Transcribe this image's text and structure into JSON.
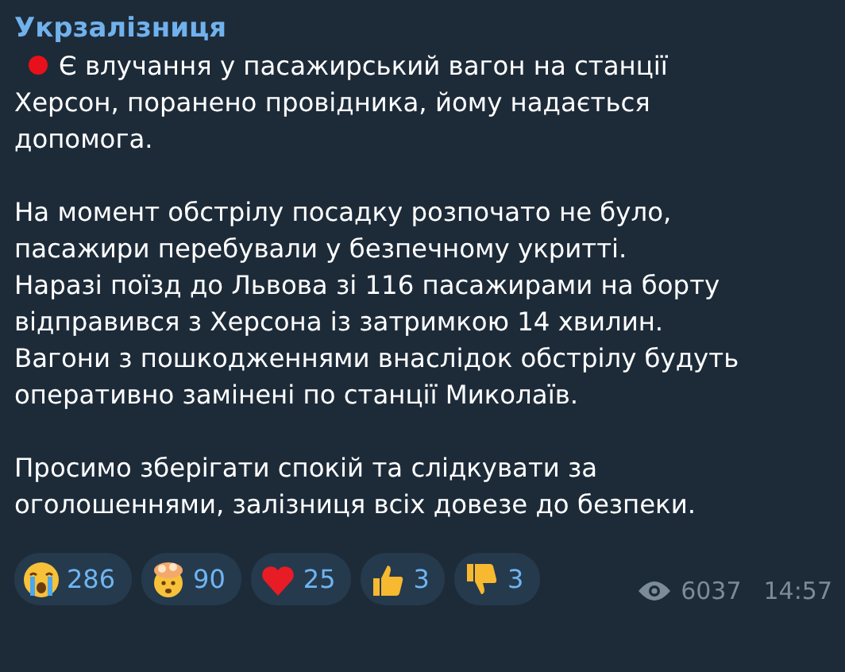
{
  "channel": {
    "name": "Укрзалізниця"
  },
  "paragraphs": [
    {
      "bullet": true,
      "lines": [
        "Є влучання у пасажирський вагон на станції",
        "Херсон, поранено провідника, йому надається",
        "допомога."
      ]
    },
    {
      "bullet": false,
      "lines": [
        "На момент обстрілу посадку розпочато не було,",
        "пасажири перебували у безпечному укритті.",
        "Наразі поїзд до Львова зі 116 пасажирами на борту",
        "відправився з Херсона із затримкою 14 хвилин.",
        "Вагони з пошкодженнями внаслідок обстрілу будуть",
        "оперативно замінені по станції Миколаїв."
      ]
    },
    {
      "bullet": false,
      "lines": [
        "Просимо зберігати спокій та слідкувати за",
        "оголошеннями, залізниця всіх довезе до безпеки."
      ]
    }
  ],
  "reactions": [
    {
      "kind": "crying",
      "count": "286"
    },
    {
      "kind": "exploding",
      "count": "90"
    },
    {
      "kind": "heart",
      "count": "25"
    },
    {
      "kind": "thumbsup",
      "count": "3"
    },
    {
      "kind": "thumbsdown",
      "count": "3"
    }
  ],
  "views": "6037",
  "time": "14:57"
}
